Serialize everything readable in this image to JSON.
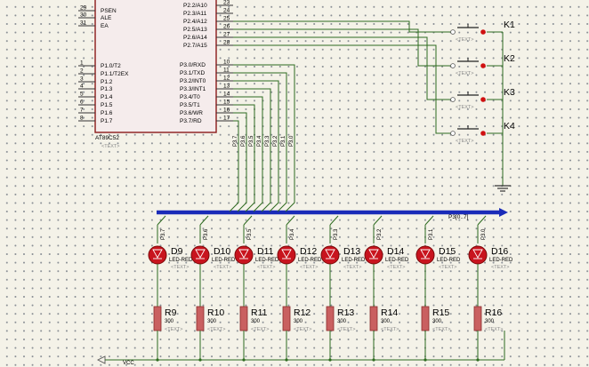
{
  "mcu": {
    "name": "AT89C52",
    "text_placeholder": "<TEXT>",
    "left_pins": [
      {
        "num": "29",
        "label": "PSEN"
      },
      {
        "num": "30",
        "label": "ALE"
      },
      {
        "num": "31",
        "label": "EA"
      },
      {
        "num": "1",
        "label": "P1.0/T2"
      },
      {
        "num": "2",
        "label": "P1.1/T2EX"
      },
      {
        "num": "3",
        "label": "P1.2"
      },
      {
        "num": "4",
        "label": "P1.3"
      },
      {
        "num": "5",
        "label": "P1.4"
      },
      {
        "num": "6",
        "label": "P1.5"
      },
      {
        "num": "7",
        "label": "P1.6"
      },
      {
        "num": "8",
        "label": "P1.7"
      }
    ],
    "right_pins_p2": [
      {
        "num": "23",
        "label": "P2.2/A10"
      },
      {
        "num": "24",
        "label": "P2.3/A11"
      },
      {
        "num": "25",
        "label": "P2.4/A12"
      },
      {
        "num": "26",
        "label": "P2.5/A13"
      },
      {
        "num": "27",
        "label": "P2.6/A14"
      },
      {
        "num": "28",
        "label": "P2.7/A15"
      }
    ],
    "right_pins_p3": [
      {
        "num": "10",
        "label": "P3.0/RXD"
      },
      {
        "num": "11",
        "label": "P3.1/TXD"
      },
      {
        "num": "12",
        "label": "P3.2/INT0"
      },
      {
        "num": "13",
        "label": "P3.3/INT1"
      },
      {
        "num": "14",
        "label": "P3.4/T0"
      },
      {
        "num": "15",
        "label": "P3.5/T1"
      },
      {
        "num": "16",
        "label": "P3.6/WR"
      },
      {
        "num": "17",
        "label": "P3.7/RD"
      }
    ]
  },
  "keys": [
    "K1",
    "K2",
    "K3",
    "K4"
  ],
  "bus_label": "P3[0..7]",
  "branch_labels": [
    "P3.7",
    "P3.6",
    "P3.5",
    "P3.4",
    "P3.3",
    "P3.2",
    "P3.1",
    "P3.0"
  ],
  "leds": [
    {
      "ref": "D9",
      "value": "LED-RED"
    },
    {
      "ref": "D10",
      "value": "LED-RED"
    },
    {
      "ref": "D11",
      "value": "LED-RED"
    },
    {
      "ref": "D12",
      "value": "LED-RED"
    },
    {
      "ref": "D13",
      "value": "LED-RED"
    },
    {
      "ref": "D14",
      "value": "LED-RED"
    },
    {
      "ref": "D15",
      "value": "LED-RED"
    },
    {
      "ref": "D16",
      "value": "LED-RED"
    }
  ],
  "resistors": [
    {
      "ref": "R9",
      "value": "300"
    },
    {
      "ref": "R10",
      "value": "300"
    },
    {
      "ref": "R11",
      "value": "300"
    },
    {
      "ref": "R12",
      "value": "300"
    },
    {
      "ref": "R13",
      "value": "300"
    },
    {
      "ref": "R14",
      "value": "300"
    },
    {
      "ref": "R15",
      "value": "300"
    },
    {
      "ref": "R16",
      "value": "300"
    }
  ],
  "vcc_label": "VCC",
  "colors": {
    "wire": "#2d6b1f",
    "bus": "#1a2bb8",
    "component_body": "#c96060",
    "led_fill": "#c8141e",
    "chip_fill": "#f5ecec",
    "chip_border": "#8b1a1a"
  }
}
